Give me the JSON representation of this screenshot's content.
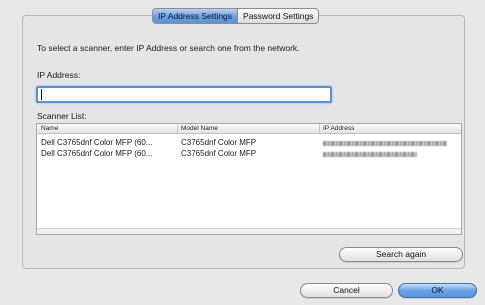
{
  "tabs": [
    {
      "label": "IP Address Settings",
      "active": true
    },
    {
      "label": "Password Settings",
      "active": false
    }
  ],
  "instruction": "To select a scanner, enter IP Address or search one from the network.",
  "ip_address": {
    "label": "IP Address:",
    "value": ""
  },
  "scanner_list": {
    "label": "Scanner List:",
    "columns": [
      "Name",
      "Model Name",
      "IP Address"
    ],
    "rows": [
      {
        "name": "Dell C3765dnf Color MFP (60...",
        "model": "C3765dnf Color MFP",
        "ip": "[redacted]"
      },
      {
        "name": "Dell C3765dnf Color MFP (60...",
        "model": "C3765dnf Color MFP",
        "ip": "[redacted]"
      }
    ]
  },
  "buttons": {
    "search_again": "Search again",
    "cancel": "Cancel",
    "ok": "OK"
  },
  "colors": {
    "accent": "#5a94dc",
    "focus_ring": "#5b8fd9"
  }
}
